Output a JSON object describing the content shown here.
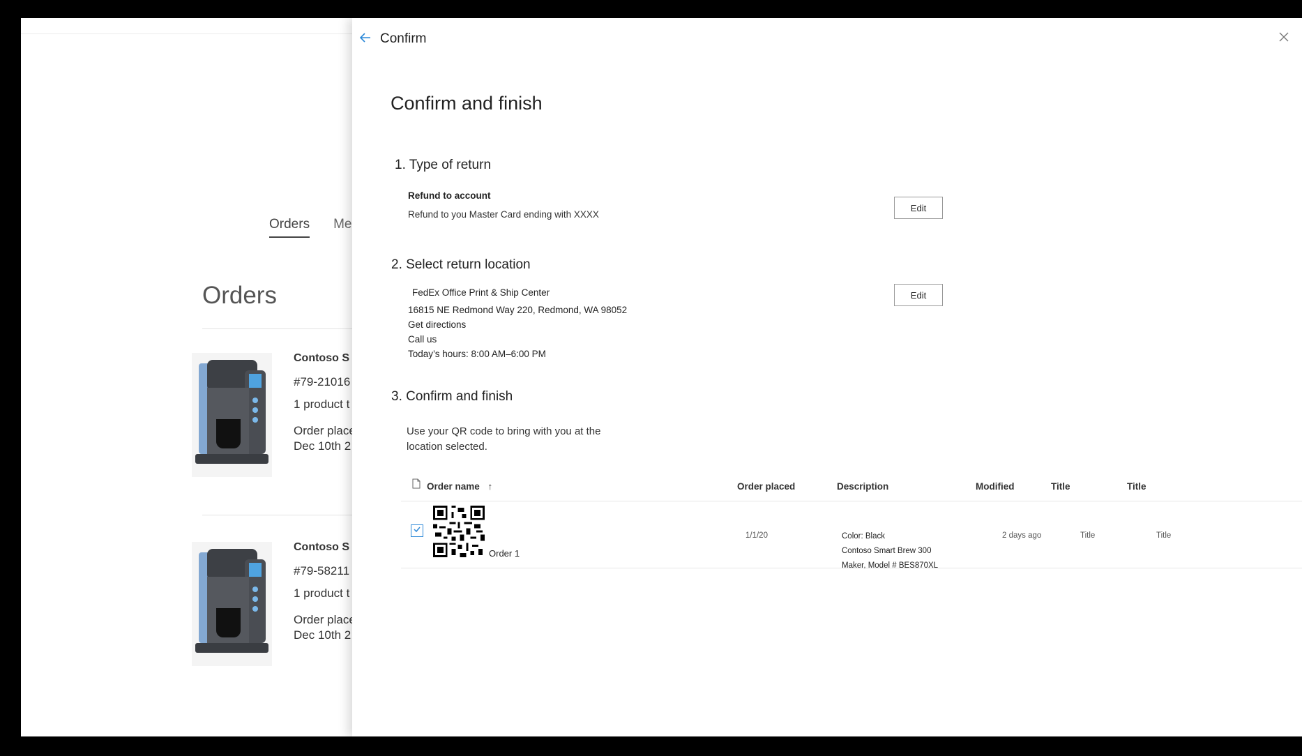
{
  "background": {
    "tabs": [
      "Orders",
      "Me"
    ],
    "page_title": "Orders",
    "orders": [
      {
        "name": "Contoso S",
        "number": "#79-21016",
        "products": "1 product t",
        "placed_label": "Order place",
        "placed_date": "Dec 10th 2"
      },
      {
        "name": "Contoso S",
        "number": "#79-58211",
        "products": "1 product t",
        "placed_label": "Order place",
        "placed_date": "Dec 10th 2"
      }
    ]
  },
  "panel": {
    "header_title": "Confirm",
    "heading": "Confirm and finish",
    "section1": {
      "title": "1. Type of return",
      "label": "Refund to account",
      "detail": "Refund to you Master Card ending with XXXX",
      "edit_label": "Edit"
    },
    "section2": {
      "title": "2. Select return location",
      "name": "FedEx Office Print & Ship Center",
      "address": "16815 NE Redmond Way 220, Redmond, WA 98052",
      "directions": "Get directions",
      "call": "Call us",
      "hours": "Today’s hours: 8:00 AM–6:00 PM",
      "edit_label": "Edit"
    },
    "section3": {
      "title": "3. Confirm and finish",
      "description": "Use your QR code to bring with you at the location selected."
    },
    "table": {
      "columns": [
        "Order name",
        "Order placed",
        "Description",
        "Modified",
        "Title",
        "Title"
      ],
      "sort_indicator": "↑",
      "rows": [
        {
          "checked": true,
          "order_name": "Order 1",
          "order_placed": "1/1/20",
          "description": [
            "Color: Black",
            "Contoso Smart Brew 300",
            "Maker, Model # BES870XL"
          ],
          "modified": "2 days ago",
          "title1": "Title",
          "title2": "Title"
        }
      ]
    }
  },
  "icons": {
    "back": "arrow-left-icon",
    "close": "close-icon",
    "file": "file-icon",
    "check": "checkbox-checked-icon",
    "qr": "qr-code-icon"
  },
  "colors": {
    "accent": "#2b88d8",
    "text": "#222222"
  }
}
